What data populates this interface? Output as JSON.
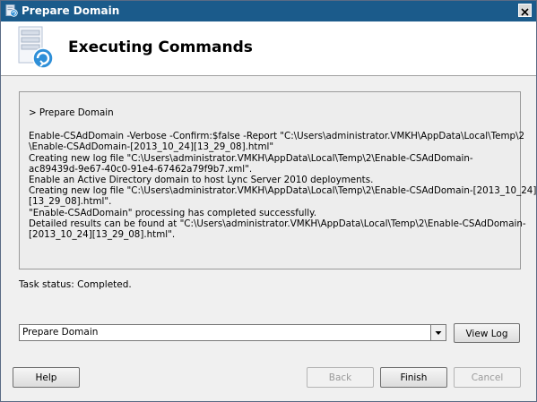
{
  "window": {
    "title": "Prepare Domain",
    "close_label": "✕"
  },
  "header": {
    "title": "Executing Commands"
  },
  "log": {
    "prompt": "> Prepare Domain",
    "lines": [
      "Enable-CSAdDomain -Verbose -Confirm:$false -Report \"C:\\Users\\administrator.VMKH\\AppData\\Local\\Temp\\2",
      "\\Enable-CSAdDomain-[2013_10_24][13_29_08].html\"",
      "Creating new log file \"C:\\Users\\administrator.VMKH\\AppData\\Local\\Temp\\2\\Enable-CSAdDomain-",
      "ac89439d-9e67-40c0-91e4-67462a79f9b7.xml\".",
      "Enable an Active Directory domain to host Lync Server 2010 deployments.",
      "Creating new log file \"C:\\Users\\administrator.VMKH\\AppData\\Local\\Temp\\2\\Enable-CSAdDomain-[2013_10_24]",
      "[13_29_08].html\".",
      "\"Enable-CSAdDomain\" processing has completed successfully.",
      "Detailed results can be found at \"C:\\Users\\administrator.VMKH\\AppData\\Local\\Temp\\2\\Enable-CSAdDomain-",
      "[2013_10_24][13_29_08].html\"."
    ]
  },
  "status": {
    "text": "Task status: Completed."
  },
  "log_select": {
    "selected": "Prepare Domain"
  },
  "buttons": {
    "view_log": "View Log",
    "help": "Help",
    "back": "Back",
    "finish": "Finish",
    "cancel": "Cancel"
  },
  "colors": {
    "titlebar": "#1b5b8b",
    "log_bg": "#ededed"
  }
}
